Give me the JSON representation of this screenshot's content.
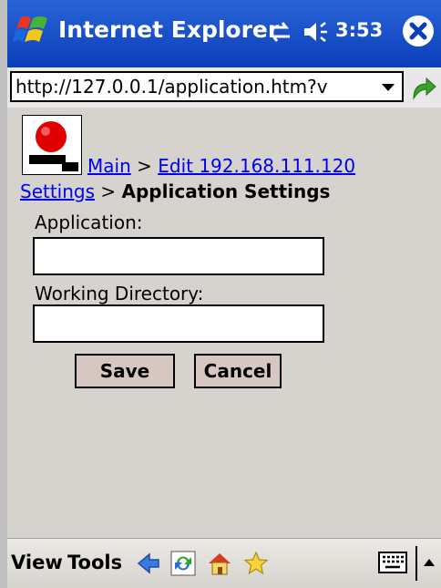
{
  "titlebar": {
    "app_title": "Internet Explorer",
    "clock": "3:53"
  },
  "addressbar": {
    "url": "http://127.0.0.1/application.htm?v"
  },
  "breadcrumb": {
    "main": "Main",
    "separator1": " > ",
    "edit": "Edit 192.168.111.120",
    "settings": "Settings",
    "separator2": " > ",
    "current": "Application Settings"
  },
  "form": {
    "application_label": "Application:",
    "application_value": "",
    "working_dir_label": "Working Directory:",
    "working_dir_value": "",
    "save_label": "Save",
    "cancel_label": "Cancel"
  },
  "toolbar": {
    "view_label": "View",
    "tools_label": "Tools",
    "icons": [
      "back-icon",
      "refresh-icon",
      "home-icon",
      "favorites-icon",
      "keyboard-icon",
      "sip-arrow-icon"
    ]
  },
  "colors": {
    "titlebar": "#0a3fb8",
    "link": "#0000ee",
    "background": "#d6d3ce",
    "button": "#d6c8c0"
  }
}
